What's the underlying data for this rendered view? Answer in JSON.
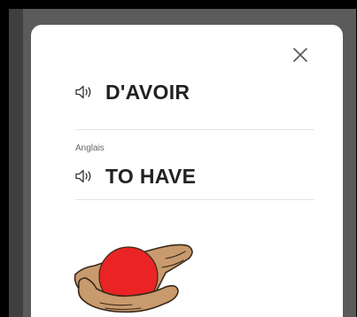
{
  "dialog": {
    "source_word": "D'AVOIR",
    "target_language": "Anglais",
    "target_word": "TO HAVE",
    "close_icon": "close-icon",
    "speaker_icon": "speaker-icon",
    "illustration_icon": "hands-holding-ball-icon"
  },
  "colors": {
    "backdrop": "#5b5b5b",
    "card": "#ffffff",
    "text": "#222222",
    "ball": "#ea2424",
    "skin": "#c99a6e"
  }
}
